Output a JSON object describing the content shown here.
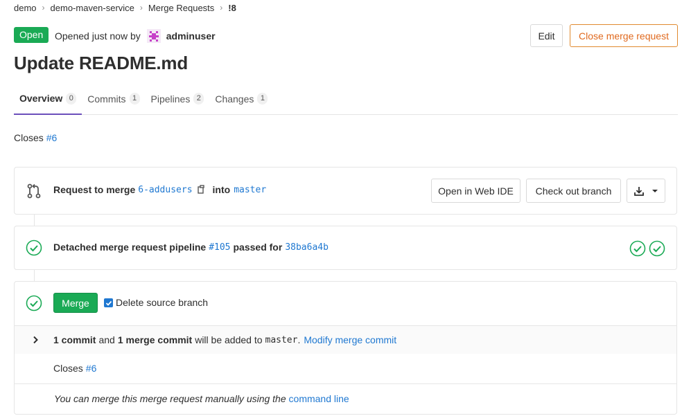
{
  "breadcrumb": [
    "demo",
    "demo-maven-service",
    "Merge Requests",
    "!8"
  ],
  "status": "Open",
  "opened_text": "Opened just now by",
  "author": "adminuser",
  "buttons": {
    "edit": "Edit",
    "close": "Close merge request"
  },
  "title": "Update README.md",
  "tabs": [
    {
      "label": "Overview",
      "count": "0"
    },
    {
      "label": "Commits",
      "count": "1"
    },
    {
      "label": "Pipelines",
      "count": "2"
    },
    {
      "label": "Changes",
      "count": "1"
    }
  ],
  "description": {
    "prefix": "Closes",
    "issue": "#6"
  },
  "branch_widget": {
    "request_to_merge": "Request to merge",
    "source_branch": "6-addusers",
    "into": "into",
    "target_branch": "master",
    "open_web_ide": "Open in Web IDE",
    "check_out_branch": "Check out branch"
  },
  "pipeline_widget": {
    "label": "Detached merge request pipeline",
    "pipeline_id": "#105",
    "passed_for": "passed for",
    "commit_sha": "38ba6a4b"
  },
  "merge_widget": {
    "merge_button": "Merge",
    "delete_source_branch": "Delete source branch",
    "commits_count": "1 commit",
    "and": "and",
    "merge_commits": "1 merge commit",
    "will_be_added": "will be added to",
    "target": "master",
    "period": ".",
    "modify_link": "Modify merge commit",
    "closes_prefix": "Closes",
    "closes_issue": "#6",
    "manual_text": "You can merge this merge request manually using the",
    "command_line": "command line"
  },
  "colors": {
    "success": "#1aaa55",
    "link": "#1f78d1",
    "close_orange": "#e0691e",
    "tab_active": "#6b4fbb"
  }
}
